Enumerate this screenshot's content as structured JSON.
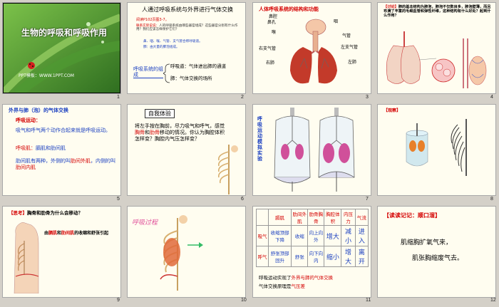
{
  "slides": [
    {
      "title": "生物的呼吸和呼吸作用",
      "footer": "PPT模板：WWW.1PPT.COM",
      "num": "1"
    },
    {
      "title": "人通过呼吸系统与外界进行气体交换",
      "subtitle": "阅读P102页图3-7。",
      "q_label": "联系实际说说：",
      "q_text": "人的呼吸系统由哪些器官组成？这些器官分别有什么作用？我们应该怎样保护它们？",
      "b1": "鼻、咽、喉、气管、支气管合称呼吸道。",
      "b2": "肺：由大量的肺泡组成。",
      "group_label": "呼吸系统的组成",
      "ra": "呼吸道：气体进出肺的通道",
      "rb": "肺：气体交换的场所",
      "num": "2"
    },
    {
      "title": "人体呼吸系统的结构和功能",
      "labels": [
        "鼻腔",
        "鼻孔",
        "咽",
        "喉",
        "气管",
        "右支气管",
        "左支气管",
        "右肺",
        "左肺"
      ],
      "num": "3"
    },
    {
      "tag": "【讨论】",
      "text": "肺的基本结构为肺泡，肺泡不仅数目多，肺泡壁薄，而且布满了丰富的毛细血管和弹性纤维，这种结构有什么好处？起到什么作用？",
      "num": "4"
    },
    {
      "title": "外界与肺（泡）的气体交换",
      "h1": "呼吸运动：",
      "p1": "吸气和呼气两个动作合起来就是呼吸运动。",
      "h2": "呼吸肌：",
      "h2b": "膈肌和肋间肌",
      "p2a": "肋间肌有两种，外侧的叫",
      "p2b": "肋间外肌",
      "p2c": "，内侧的叫",
      "p2d": "肋间内肌",
      "num": "5"
    },
    {
      "title": "自我体验",
      "t1": "将左手按在胸前，尽力吸气和呼气，感觉",
      "t2": "胸骨",
      "t3": "和",
      "t4": "肋骨",
      "t5": "移动的情况。你认为胸腔体积怎样变？胸腔内气压怎样变？",
      "num": "6"
    },
    {
      "side": "呼吸运动模拟实验",
      "num": "7"
    },
    {
      "tag": "【观察】",
      "num": "8"
    },
    {
      "tag": "【思考】",
      "question": "胸骨和肋骨为什么会移动？",
      "a1": "由",
      "a2": "膈肌",
      "a3": "和",
      "a4": "肋间肌",
      "a5": "的收缩和舒张引起",
      "num": "9"
    },
    {
      "title": "呼吸过程",
      "num": "10"
    },
    {
      "headers": [
        "膈肌",
        "肋间外肌",
        "肋骨胸骨",
        "胸腔体积",
        "内压力",
        "气流"
      ],
      "row1_label": "吸气",
      "row1": [
        "收缩顶部下降",
        "收缩",
        "向上向外",
        "增大",
        "减小",
        "进入"
      ],
      "row2_label": "呼气",
      "row2": [
        "舒张顶部回升",
        "舒张",
        "向下向内",
        "缩小",
        "增大",
        "离开"
      ],
      "f1": "呼吸运动实现了",
      "f2": "外界与肺的气体交换",
      "f3": "气体交换原理是",
      "f4": "气压差",
      "num": "11"
    },
    {
      "tag": "【读读记记：顺口溜】",
      "l1": "肌缩胸扩氧气来，",
      "l2": "肌张胸缩废气去。",
      "num": "12"
    }
  ],
  "colors": {
    "red": "#d40000",
    "blue": "#1a3fc0",
    "slide_bg": "#fffdf0",
    "canvas": "#d4d0c8"
  }
}
